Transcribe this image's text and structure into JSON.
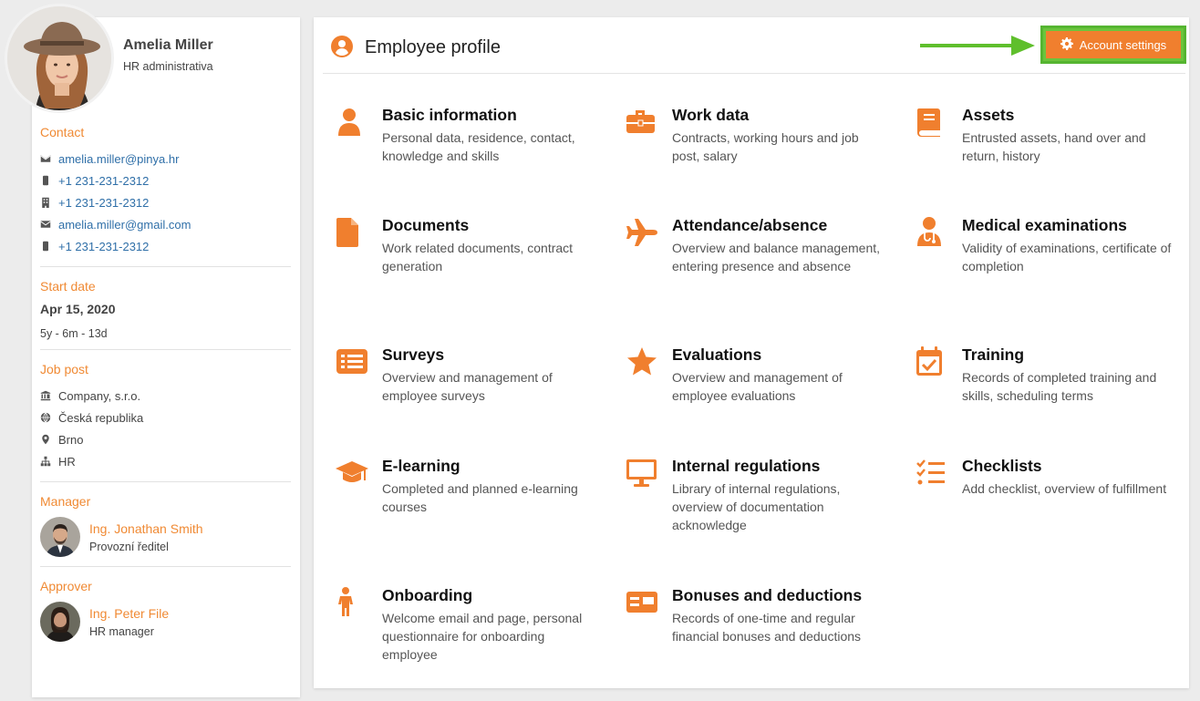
{
  "profile": {
    "name": "Amelia Miller",
    "role": "HR administrativa"
  },
  "contact": {
    "title": "Contact",
    "items": [
      {
        "icon": "envelope-icon",
        "value": "amelia.miller@pinya.hr"
      },
      {
        "icon": "mobile-phone-icon",
        "value": "+1 231-231-2312"
      },
      {
        "icon": "building-icon",
        "value": "+1 231-231-2312"
      },
      {
        "icon": "envelope-icon",
        "value": "amelia.miller@gmail.com"
      },
      {
        "icon": "mobile-phone-icon",
        "value": "+1 231-231-2312"
      }
    ]
  },
  "start": {
    "title": "Start date",
    "date": "Apr 15, 2020",
    "duration": "5y - 6m - 13d"
  },
  "job": {
    "title": "Job post",
    "items": [
      {
        "icon": "institution-icon",
        "value": "Company, s.r.o."
      },
      {
        "icon": "globe-icon",
        "value": "Česká republika"
      },
      {
        "icon": "map-pin-icon",
        "value": "Brno"
      },
      {
        "icon": "org-chart-icon",
        "value": "HR"
      }
    ]
  },
  "manager": {
    "title": "Manager",
    "name": "Ing. Jonathan Smith",
    "role": "Provozní ředitel"
  },
  "approver": {
    "title": "Approver",
    "name": "Ing. Peter File",
    "role": "HR manager"
  },
  "header": {
    "title": "Employee profile",
    "settings_label": "Account settings"
  },
  "colors": {
    "accent": "#f07f2e",
    "highlight": "#6bc43d",
    "link": "#2f6fa8"
  },
  "tiles": [
    {
      "title": "Basic information",
      "desc": "Personal data, residence, contact, knowledge and skills",
      "icon": "user-icon"
    },
    {
      "title": "Work data",
      "desc": "Contracts, working hours and job post, salary",
      "icon": "briefcase-icon"
    },
    {
      "title": "Assets",
      "desc": "Entrusted assets, hand over and return, history",
      "icon": "book-icon"
    },
    {
      "title": "Documents",
      "desc": "Work related documents, contract generation",
      "icon": "document-icon"
    },
    {
      "title": "Attendance/absence",
      "desc": "Overview and balance management, entering presence and absence",
      "icon": "plane-icon"
    },
    {
      "title": "Medical examinations",
      "desc": "Validity of examinations, certificate of completion",
      "icon": "doctor-icon"
    },
    {
      "title": "Surveys",
      "desc": "Overview and management of employee surveys",
      "icon": "list-icon"
    },
    {
      "title": "Evaluations",
      "desc": "Overview and management of employee evaluations",
      "icon": "star-icon"
    },
    {
      "title": "Training",
      "desc": "Records of completed training and skills, scheduling terms",
      "icon": "calendar-check-icon"
    },
    {
      "title": "E-learning",
      "desc": "Completed and planned e-learning courses",
      "icon": "graduation-cap-icon"
    },
    {
      "title": "Internal regulations",
      "desc": "Library of internal regulations, overview of documentation acknowledge",
      "icon": "monitor-icon"
    },
    {
      "title": "Checklists",
      "desc": "Add checklist, overview of fulfillment",
      "icon": "checklist-icon"
    },
    {
      "title": "Onboarding",
      "desc": "Welcome email and page, personal questionnaire for onboarding employee",
      "icon": "person-child-icon"
    },
    {
      "title": "Bonuses and deductions",
      "desc": "Records of one-time and regular financial bonuses and deductions",
      "icon": "money-card-icon"
    }
  ]
}
